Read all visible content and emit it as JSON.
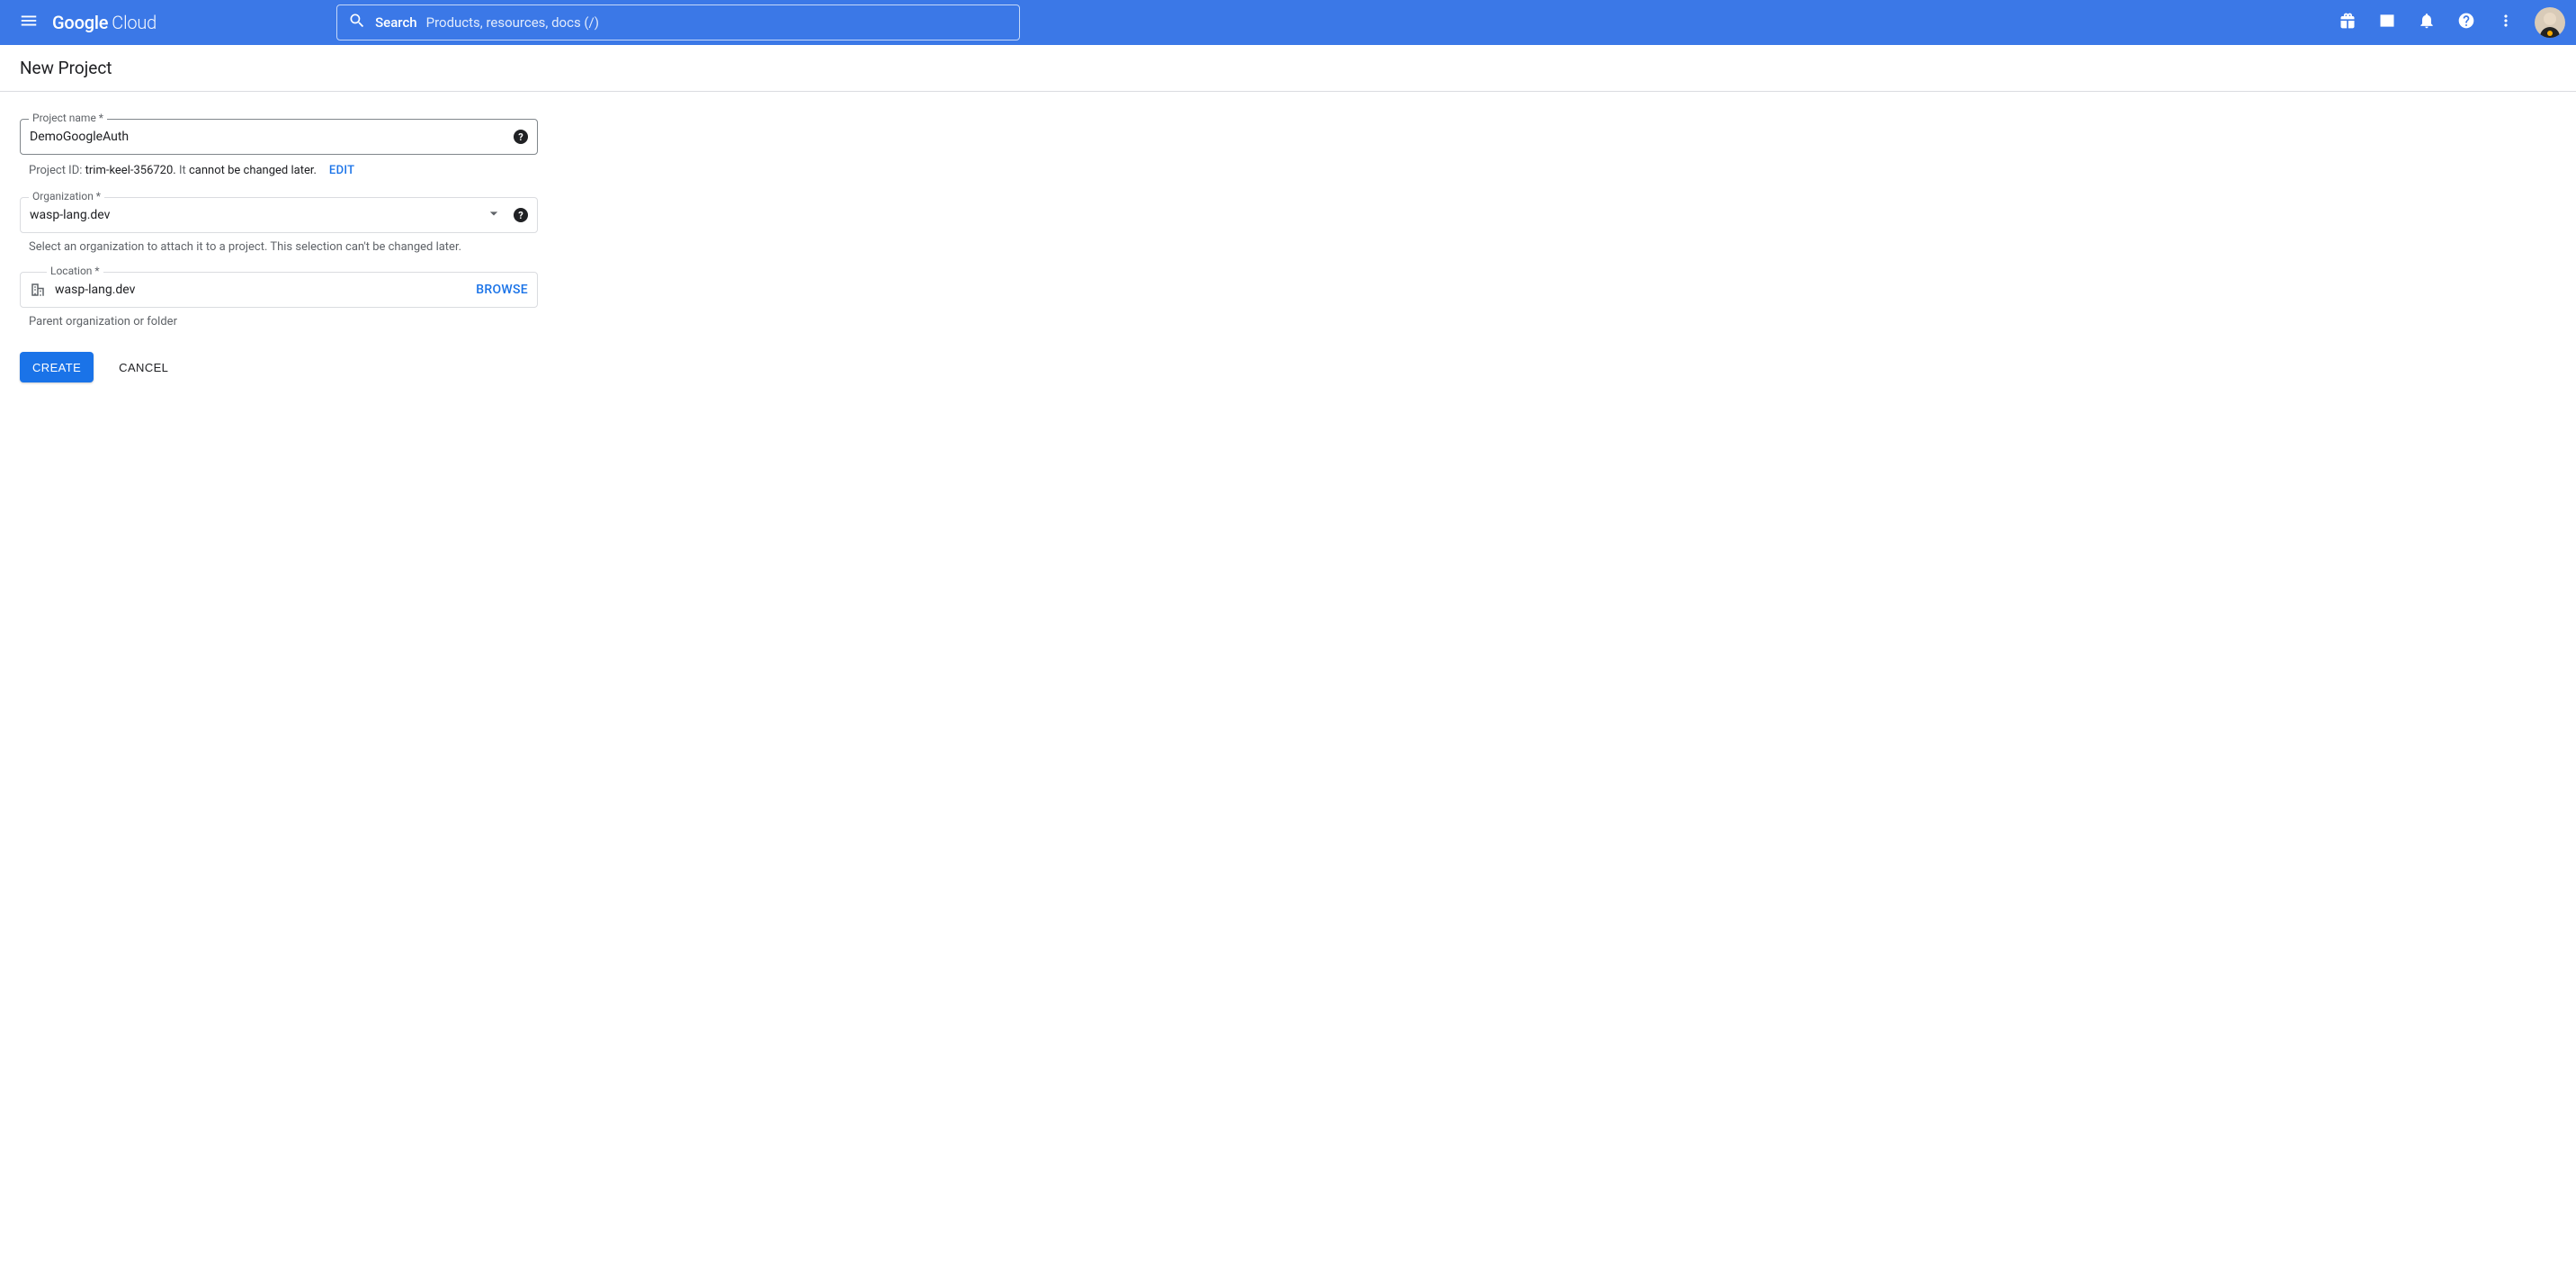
{
  "header": {
    "logo_google": "Google",
    "logo_cloud": "Cloud",
    "search_label": "Search",
    "search_placeholder": "Products, resources, docs (/)"
  },
  "page": {
    "title": "New Project"
  },
  "form": {
    "project_name": {
      "label": "Project name *",
      "value": "DemoGoogleAuth"
    },
    "project_id_row": {
      "prefix": "Project ID:",
      "id_value": "trim-keel-356720",
      "suffix_dot": ". ",
      "suffix_it": "It ",
      "cannot_change": "cannot be changed later.",
      "edit": "EDIT"
    },
    "organization": {
      "label": "Organization *",
      "value": "wasp-lang.dev",
      "helper": "Select an organization to attach it to a project. This selection can't be changed later."
    },
    "location": {
      "label": "Location *",
      "value": "wasp-lang.dev",
      "browse": "BROWSE",
      "helper": "Parent organization or folder"
    },
    "buttons": {
      "create": "CREATE",
      "cancel": "CANCEL"
    }
  }
}
